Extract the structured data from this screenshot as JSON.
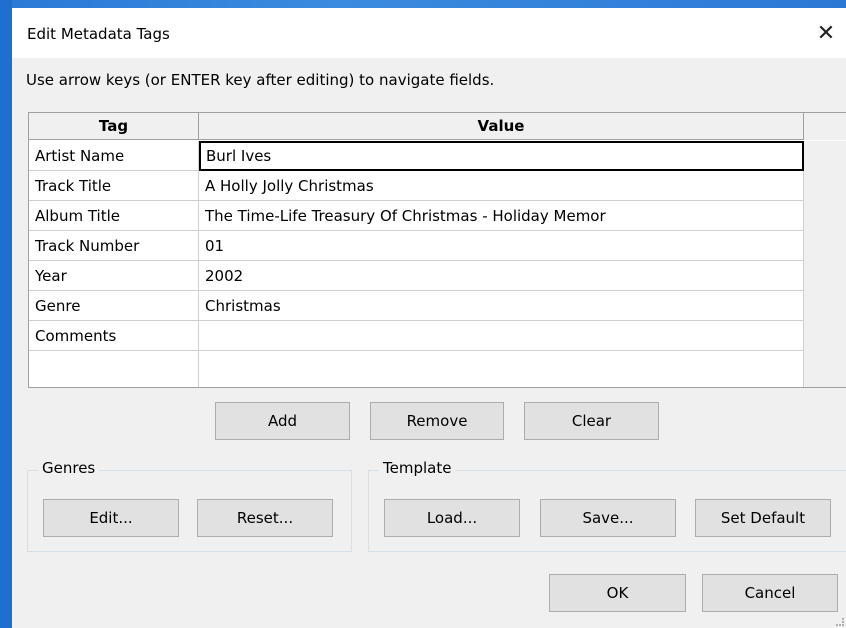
{
  "dialog": {
    "title": "Edit Metadata Tags",
    "close_glyph": "✕",
    "instructions": "Use arrow keys (or ENTER key after editing) to navigate fields."
  },
  "table": {
    "headers": {
      "tag": "Tag",
      "value": "Value"
    },
    "rows": [
      {
        "tag": "Artist Name",
        "value": "Burl Ives"
      },
      {
        "tag": "Track Title",
        "value": "A Holly Jolly Christmas"
      },
      {
        "tag": "Album Title",
        "value": "The Time-Life Treasury Of Christmas - Holiday Memor"
      },
      {
        "tag": "Track Number",
        "value": "01"
      },
      {
        "tag": "Year",
        "value": "2002"
      },
      {
        "tag": "Genre",
        "value": "Christmas"
      },
      {
        "tag": "Comments",
        "value": ""
      },
      {
        "tag": "",
        "value": ""
      }
    ]
  },
  "row_buttons": {
    "add": "Add",
    "remove": "Remove",
    "clear": "Clear"
  },
  "genres": {
    "label": "Genres",
    "edit": "Edit...",
    "reset": "Reset..."
  },
  "template": {
    "label": "Template",
    "load": "Load...",
    "save": "Save...",
    "set_default": "Set Default"
  },
  "footer": {
    "ok": "OK",
    "cancel": "Cancel"
  },
  "colors": {
    "desktop": "#1f6fd0",
    "dialog_bg": "#f0f0f0",
    "button_bg": "#e1e1e1"
  }
}
